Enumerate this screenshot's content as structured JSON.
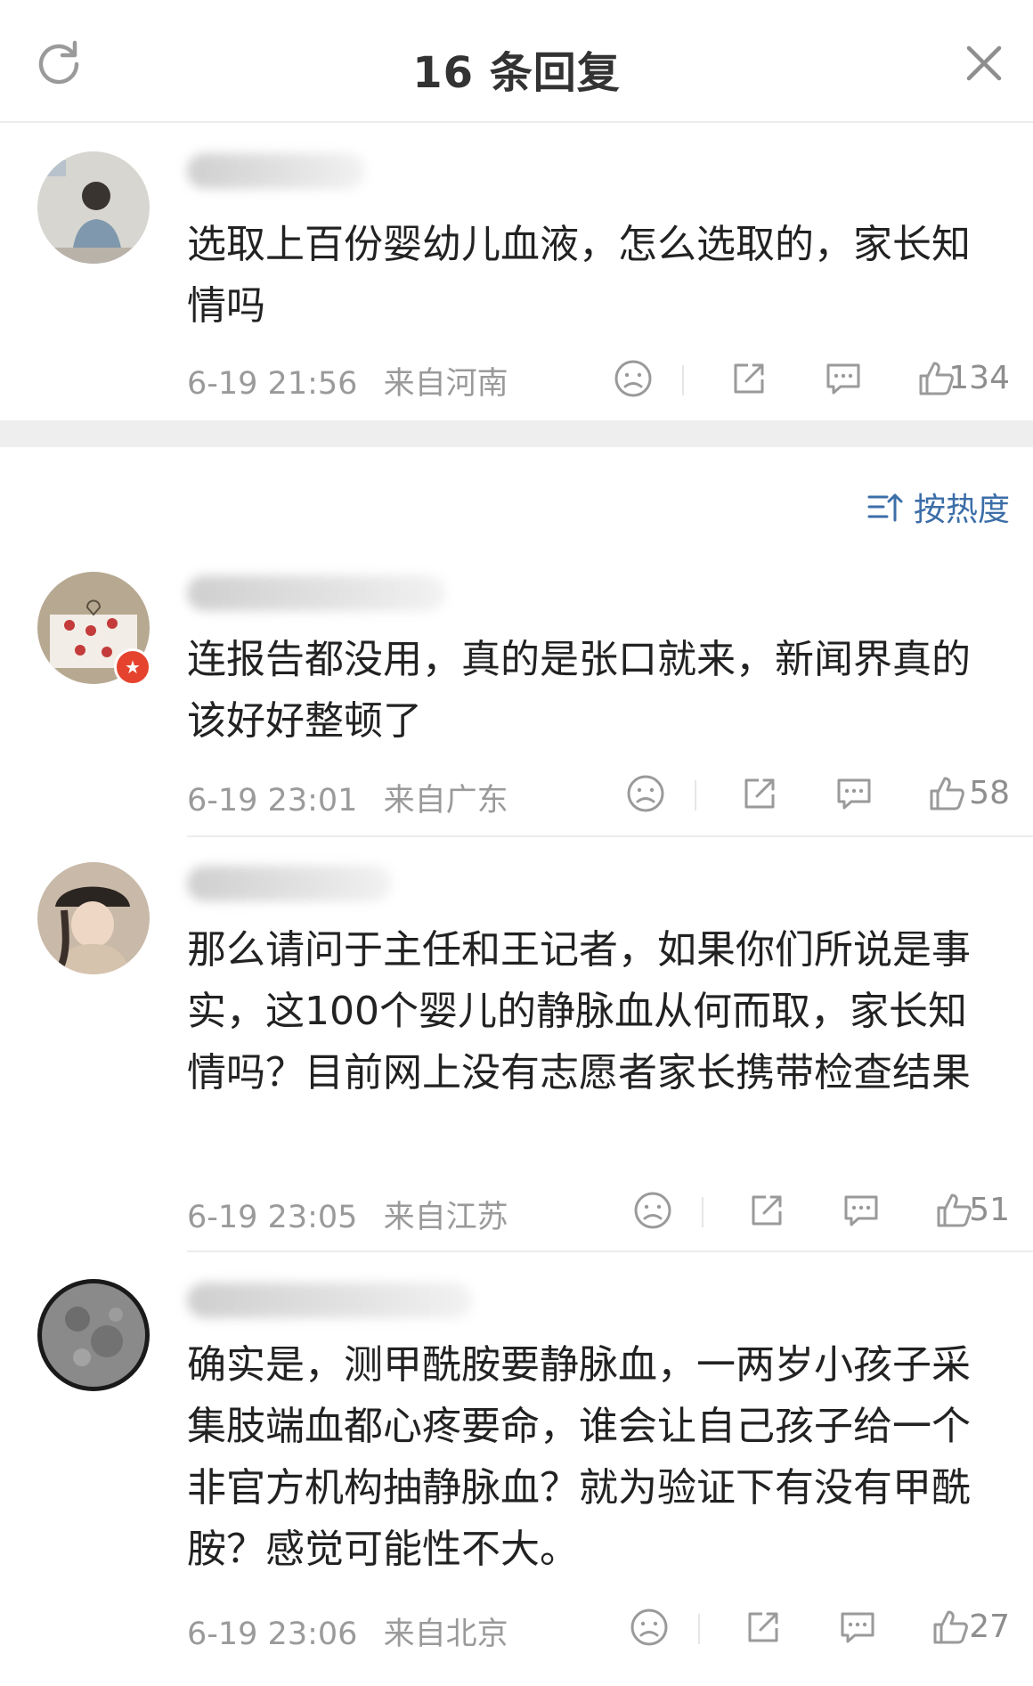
{
  "header": {
    "title": "16 条回复"
  },
  "root_comment": {
    "text": "选取上百份婴幼儿血液，怎么选取的，家长知情吗",
    "date": "6-19 21:56",
    "location": "来自河南",
    "likes": "134"
  },
  "sort": {
    "label": "按热度"
  },
  "replies": [
    {
      "text": "连报告都没用，真的是张口就来，新闻界真的该好好整顿了",
      "date": "6-19 23:01",
      "location": "来自广东",
      "likes": "58"
    },
    {
      "text": "那么请问于主任和王记者，如果你们所说是事实，这100个婴儿的静脉血从何而取，家长知情吗？目前网上没有志愿者家长携带检查结果",
      "date": "6-19 23:05",
      "location": "来自江苏",
      "likes": "51"
    },
    {
      "text": "确实是，测甲酰胺要静脉血，一两岁小孩子采集肢端血都心疼要命，谁会让自己孩子给一个非官方机构抽静脉血？就为验证下有没有甲酰胺？感觉可能性不大。",
      "date": "6-19 23:06",
      "location": "来自北京",
      "likes": "27"
    }
  ],
  "colors": {
    "accent": "#3c6ea8",
    "badge": "#e6432e",
    "meta": "#9a9a9a"
  },
  "icons": [
    "refresh-icon",
    "close-icon",
    "sad-face-icon",
    "share-icon",
    "comment-icon",
    "thumbs-up-icon",
    "sort-icon",
    "verified-badge-icon"
  ]
}
